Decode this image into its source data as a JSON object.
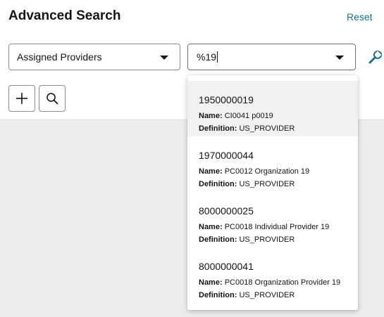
{
  "header": {
    "title": "Advanced Search",
    "reset_label": "Reset"
  },
  "search": {
    "field_select": {
      "value": "Assigned Providers"
    },
    "value_select": {
      "value": "%19"
    }
  },
  "actions": {
    "add_icon": "plus-icon",
    "search_icon": "search-icon",
    "wrench_icon": "wrench-icon"
  },
  "colors": {
    "accent": "#1d6e8c",
    "highlight": "#f1f1f1"
  },
  "dropdown": {
    "name_label": "Name:",
    "definition_label": "Definition:",
    "options": [
      {
        "code": "1950000019",
        "name": "CI0041 p0019",
        "definition": "US_PROVIDER",
        "highlighted": true
      },
      {
        "code": "1970000044",
        "name": "PC0012 Organization 19",
        "definition": "US_PROVIDER"
      },
      {
        "code": "8000000025",
        "name": "PC0018 Individual Provider 19",
        "definition": "US_PROVIDER"
      },
      {
        "code": "8000000041",
        "name": "PC0018 Organization Provider 19",
        "definition": "US_PROVIDER"
      }
    ]
  }
}
